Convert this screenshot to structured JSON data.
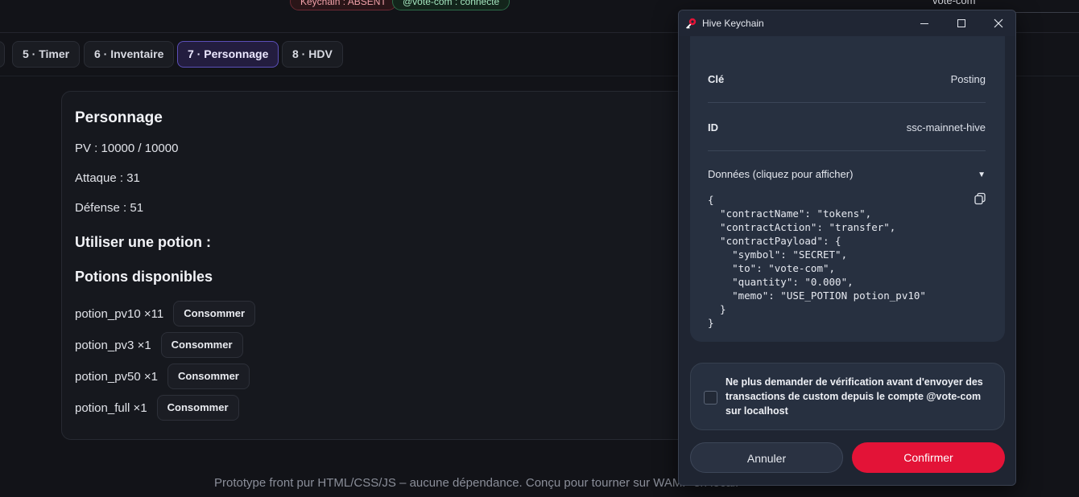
{
  "status": {
    "keychain_pill": "Keychain : ABSENT",
    "account_pill": "@vote-com : connecté",
    "account_input_value": "vote-com",
    "colors": {
      "error": "#f0a0a8",
      "success": "#a5e6bf"
    }
  },
  "tabs": [
    {
      "label": "5 · Timer",
      "active": false
    },
    {
      "label": "6 · Inventaire",
      "active": false
    },
    {
      "label": "7 · Personnage",
      "active": true
    },
    {
      "label": "8 · HDV",
      "active": false
    }
  ],
  "character": {
    "title": "Personnage",
    "hp": "PV : 10000 / 10000",
    "attack": "Attaque : 31",
    "defense": "Défense : 51",
    "use_potion_heading": "Utiliser une potion :",
    "potions_heading": "Potions disponibles",
    "consume_label": "Consommer",
    "potions": [
      {
        "label": "potion_pv10 ×11"
      },
      {
        "label": "potion_pv3 ×1"
      },
      {
        "label": "potion_pv50 ×1"
      },
      {
        "label": "potion_full ×1"
      }
    ]
  },
  "footer": {
    "text": "Prototype front pur HTML/CSS/JS – aucune dépendance. Conçu pour tourner sur WAMP en local."
  },
  "keychain": {
    "window_title": "Hive Keychain",
    "brand_color": "#e31337",
    "rows": [
      {
        "key": "Clé",
        "value": "Posting"
      },
      {
        "key": "ID",
        "value": "ssc-mainnet-hive"
      }
    ],
    "data_toggle_label": "Données (cliquez pour afficher)",
    "json_text": "{\n  \"contractName\": \"tokens\",\n  \"contractAction\": \"transfer\",\n  \"contractPayload\": {\n    \"symbol\": \"SECRET\",\n    \"to\": \"vote-com\",\n    \"quantity\": \"0.000\",\n    \"memo\": \"USE_POTION potion_pv10\"\n  }\n}",
    "checkbox_label": "Ne plus demander de vérification avant d'envoyer des transactions de custom depuis le compte @vote-com sur localhost",
    "checkbox_checked": false,
    "cancel_label": "Annuler",
    "confirm_label": "Confirmer"
  }
}
